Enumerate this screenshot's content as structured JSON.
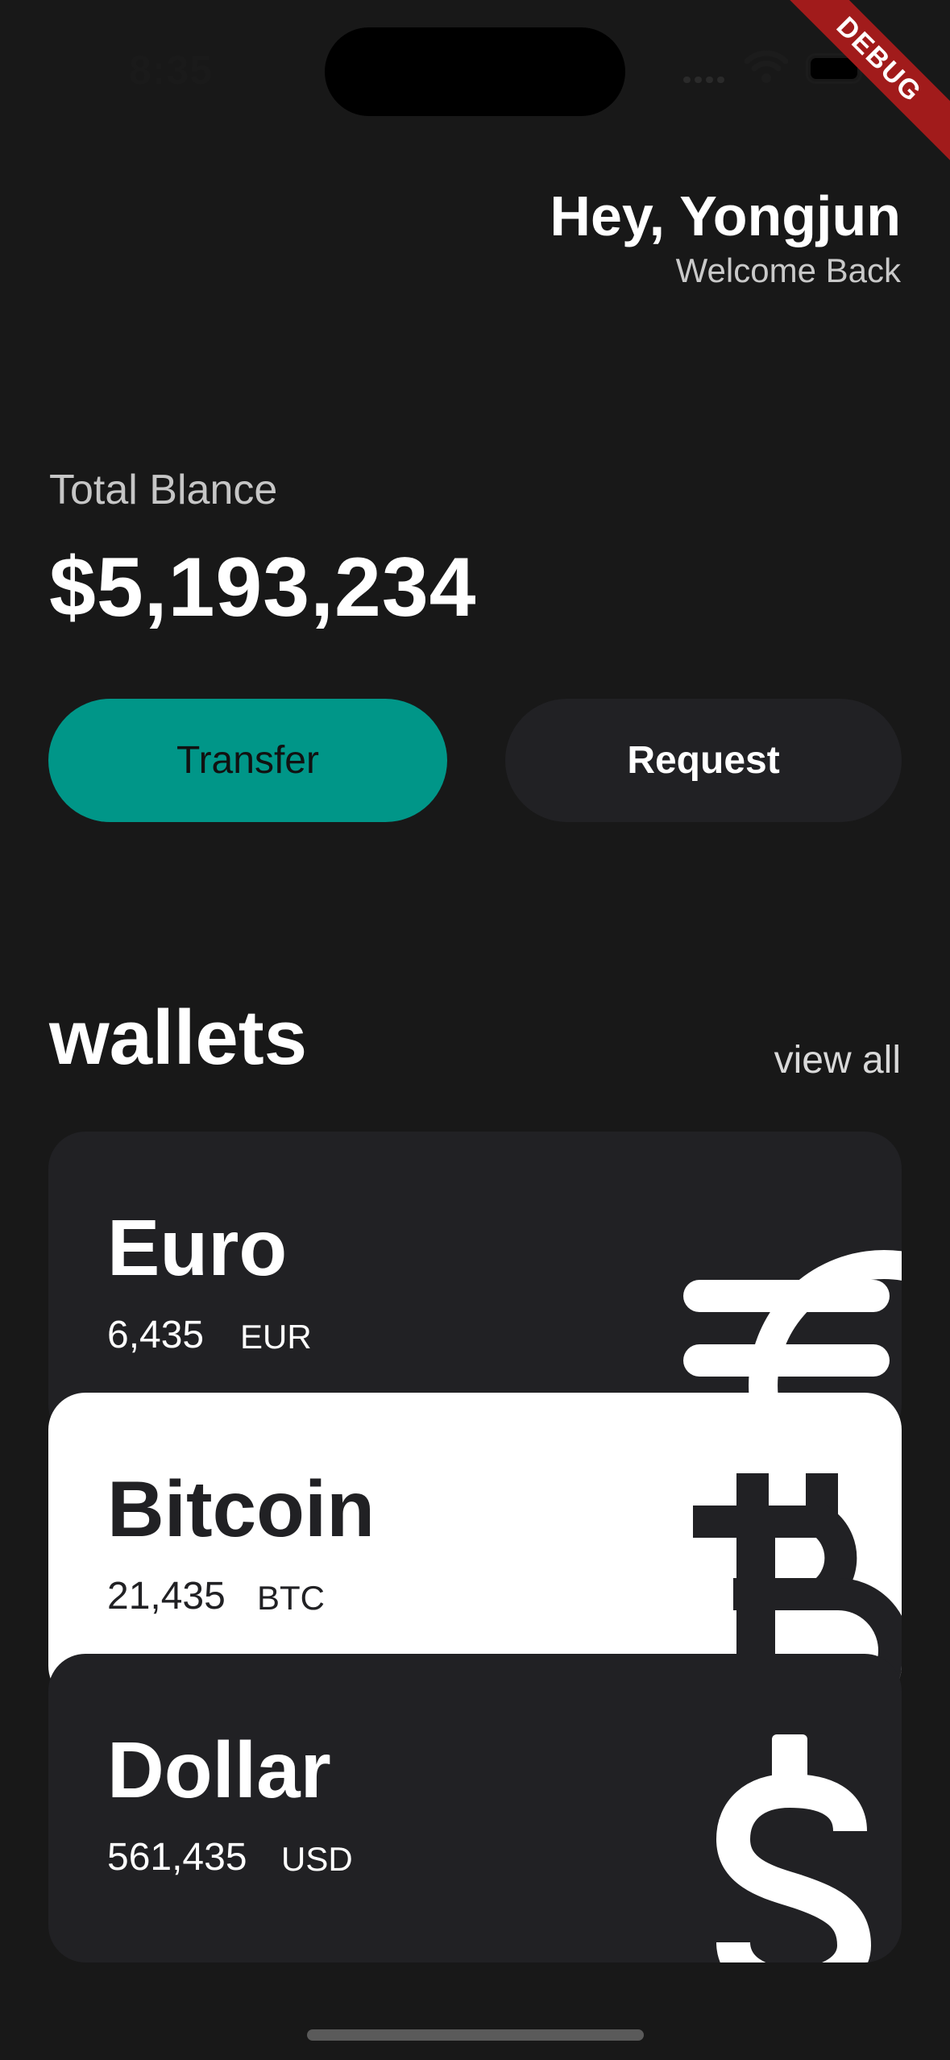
{
  "status_bar": {
    "time": "8:35"
  },
  "debug_banner": "DEBUG",
  "header": {
    "greeting": "Hey, Yongjun",
    "subtitle": "Welcome Back"
  },
  "balance": {
    "label": "Total Blance",
    "amount": "$5,193,234"
  },
  "actions": {
    "transfer": "Transfer",
    "request": "Request"
  },
  "wallets": {
    "title": "wallets",
    "view_all": "view all",
    "items": [
      {
        "name": "Euro",
        "amount": "6,435",
        "code": "EUR",
        "icon": "euro-icon"
      },
      {
        "name": "Bitcoin",
        "amount": "21,435",
        "code": "BTC",
        "icon": "bitcoin-icon"
      },
      {
        "name": "Dollar",
        "amount": "561,435",
        "code": "USD",
        "icon": "dollar-icon"
      }
    ]
  },
  "colors": {
    "background": "#181818",
    "card_dark": "#212124",
    "accent": "#009688",
    "card_light": "#ffffff"
  }
}
